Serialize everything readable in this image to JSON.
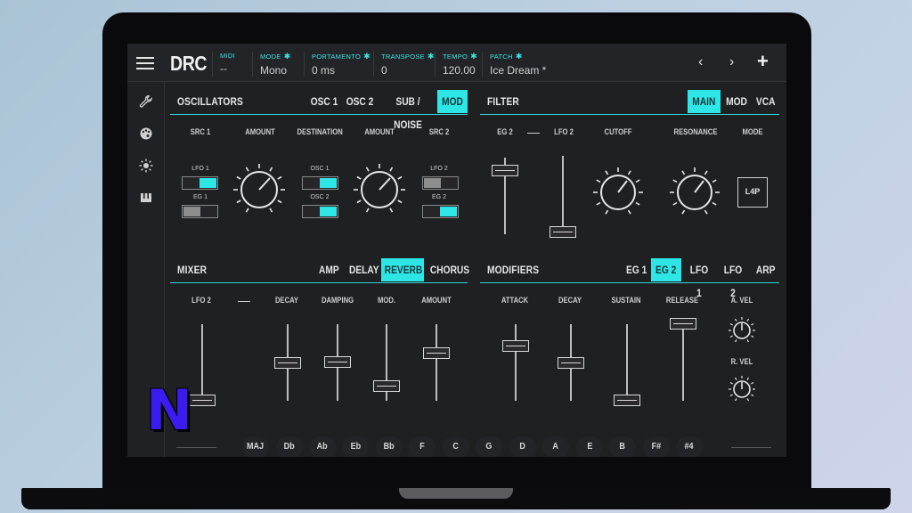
{
  "app": {
    "logo": "DRC"
  },
  "toolbar": {
    "fields": [
      {
        "label": "MIDI",
        "value": "--",
        "gear": false
      },
      {
        "label": "MODE",
        "value": "Mono",
        "gear": true
      },
      {
        "label": "PORTAMENTO",
        "value": "0 ms",
        "gear": true
      },
      {
        "label": "TRANSPOSE",
        "value": "0",
        "gear": true
      },
      {
        "label": "TEMPO",
        "value": "120.00",
        "gear": true
      },
      {
        "label": "PATCH",
        "value": "Ice Dream *",
        "gear": true
      }
    ],
    "prev": "‹",
    "next": "›",
    "add": "+"
  },
  "oscillators": {
    "title": "OSCILLATORS",
    "tabs": [
      "OSC 1",
      "OSC 2",
      "SUB / NOISE",
      "MOD"
    ],
    "active_tab": "MOD",
    "columns": [
      "SRC 1",
      "AMOUNT",
      "DESTINATION",
      "AMOUNT",
      "SRC 2"
    ],
    "src1": {
      "top": "LFO 1",
      "bottom": "EG 1",
      "top_on": true,
      "bottom_on": false
    },
    "destination": {
      "top": "OSC 1",
      "bottom": "OSC 2",
      "top_on": true,
      "bottom_on": true
    },
    "src2": {
      "top": "LFO 2",
      "bottom": "EG 2",
      "top_on": false,
      "bottom_on": true
    }
  },
  "filter": {
    "title": "FILTER",
    "tabs": [
      "MAIN",
      "MOD",
      "VCA"
    ],
    "active_tab": "MAIN",
    "columns": [
      "EG 2",
      "—",
      "LFO 2",
      "CUTOFF",
      "RESONANCE",
      "MODE"
    ],
    "mode_value": "L4P"
  },
  "mixer": {
    "title": "MIXER",
    "tabs": [
      "AMP",
      "DELAY",
      "REVERB",
      "CHORUS"
    ],
    "active_tab": "REVERB",
    "columns": [
      "LFO 2",
      "—",
      "DECAY",
      "DAMPING",
      "MOD.",
      "AMOUNT"
    ]
  },
  "modifiers": {
    "title": "MODIFIERS",
    "tabs": [
      "EG 1",
      "EG 2",
      "LFO 1",
      "LFO 2",
      "ARP"
    ],
    "active_tab": "EG 2",
    "columns": [
      "ATTACK",
      "DECAY",
      "SUSTAIN",
      "RELEASE"
    ],
    "velocity": [
      "A. VEL",
      "R. VEL"
    ]
  },
  "keys": [
    "MAJ",
    "Db",
    "Ab",
    "Eb",
    "Bb",
    "F",
    "C",
    "G",
    "D",
    "A",
    "E",
    "B",
    "F#",
    "#4"
  ],
  "badge": "N",
  "colors": {
    "accent": "#2fe6e6",
    "panel": "#1f2022",
    "text": "#d8d8d8"
  }
}
